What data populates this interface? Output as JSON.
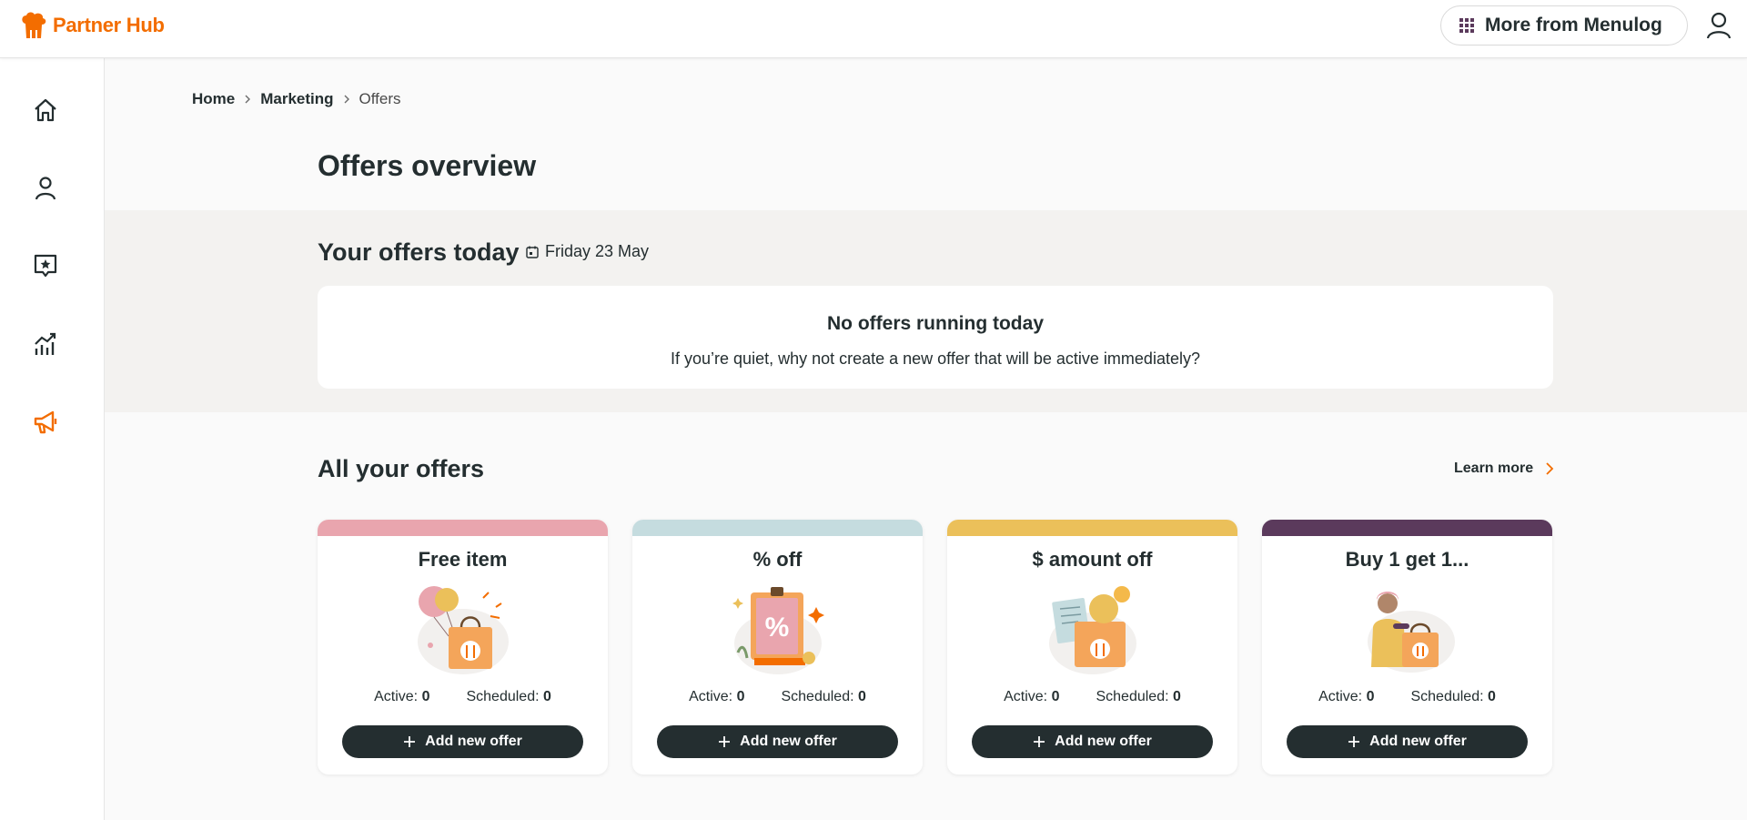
{
  "header": {
    "logo_text": "Partner Hub",
    "more_button_label": "More from Menulog",
    "brand_color": "#f36d00"
  },
  "sidebar": {
    "items": [
      {
        "icon": "home-icon",
        "active": false
      },
      {
        "icon": "person-icon",
        "active": false
      },
      {
        "icon": "review-star-icon",
        "active": false
      },
      {
        "icon": "analytics-icon",
        "active": false
      },
      {
        "icon": "megaphone-icon",
        "active": true
      }
    ]
  },
  "breadcrumb": {
    "items": [
      "Home",
      "Marketing",
      "Offers"
    ]
  },
  "page": {
    "title": "Offers overview"
  },
  "today": {
    "title": "Your offers today",
    "date": "Friday 23 May",
    "empty_title": "No offers running today",
    "empty_text": "If you’re quiet, why not create a new offer that will be active immediately?"
  },
  "all_offers": {
    "title": "All your offers",
    "learn_more": "Learn more",
    "active_label": "Active:",
    "scheduled_label": "Scheduled:",
    "add_label": "Add new offer",
    "cards": [
      {
        "title": "Free item",
        "band_color": "#e9a5ae",
        "active": "0",
        "scheduled": "0"
      },
      {
        "title": "% off",
        "band_color": "#c5dcdf",
        "active": "0",
        "scheduled": "0"
      },
      {
        "title": "$ amount off",
        "band_color": "#ebc05a",
        "active": "0",
        "scheduled": "0"
      },
      {
        "title": "Buy 1 get 1...",
        "band_color": "#5b3a5c",
        "active": "0",
        "scheduled": "0"
      }
    ]
  }
}
